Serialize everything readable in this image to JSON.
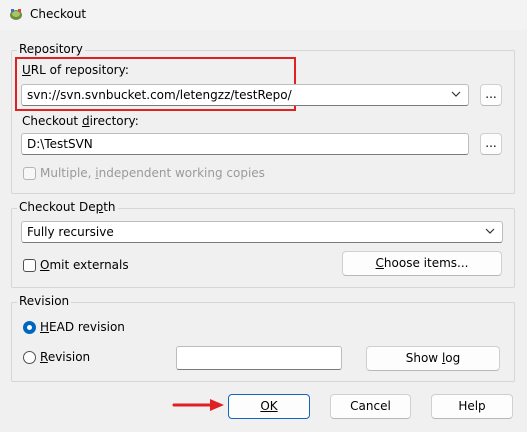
{
  "window": {
    "title": "Checkout"
  },
  "repository": {
    "group_label": "Repository",
    "url_label": "URL of repository:",
    "url_value": "svn://svn.svnbucket.com/letengzz/testRepo/",
    "browse_label": "...",
    "dir_label": "Checkout directory:",
    "dir_value": "D:\\TestSVN",
    "dir_browse_label": "...",
    "multiple_label": "Multiple, independent working copies"
  },
  "depth": {
    "group_label": "Checkout Depth",
    "selected": "Fully recursive",
    "omit_label": "Omit externals",
    "choose_label": "Choose items..."
  },
  "revision": {
    "group_label": "Revision",
    "head_label": "HEAD revision",
    "revision_label": "Revision",
    "revision_value": "",
    "showlog_label": "Show log"
  },
  "buttons": {
    "ok": "OK",
    "cancel": "Cancel",
    "help": "Help"
  },
  "colors": {
    "accent": "#0067c0",
    "highlight": "#e02121"
  }
}
